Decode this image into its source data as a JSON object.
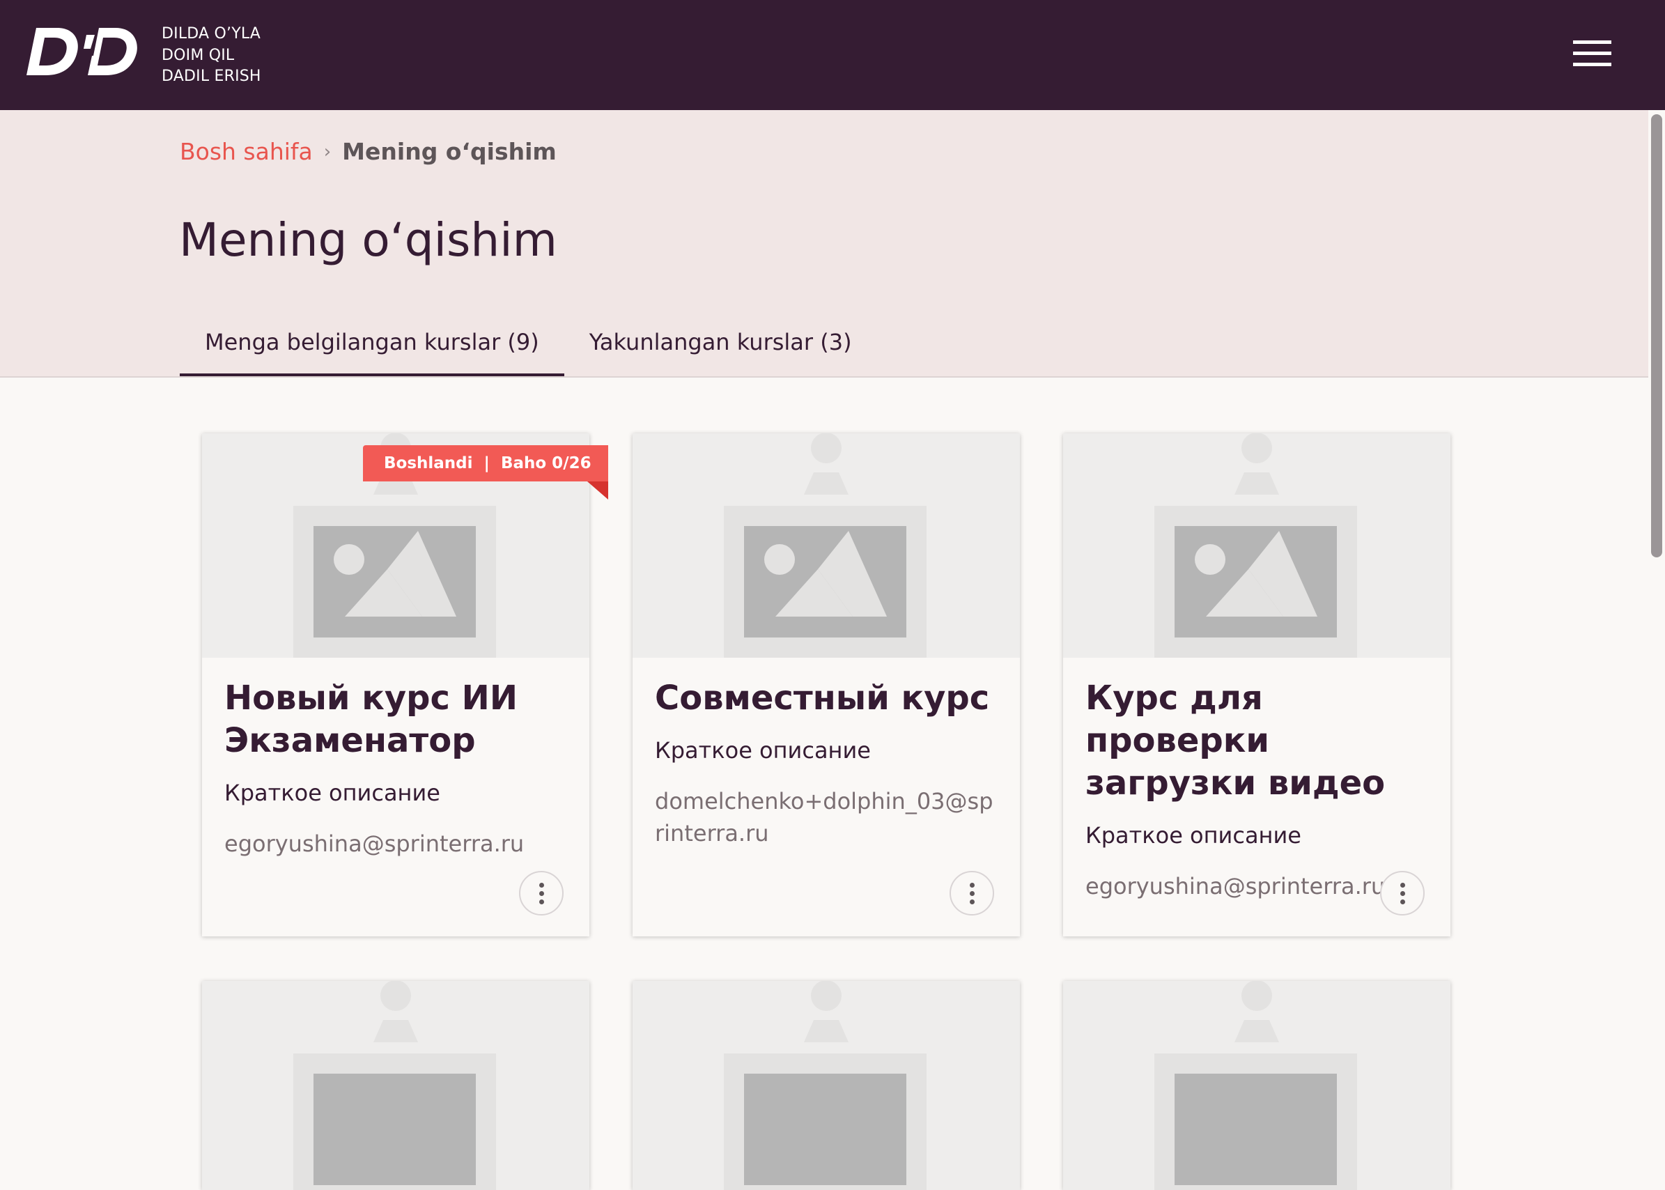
{
  "app": {
    "tagline": [
      "DILDA O’YLA",
      "DOIM QIL",
      "DADIL ERISH"
    ]
  },
  "header": {
    "menu_icon": "hamburger-menu-icon"
  },
  "breadcrumb": {
    "home": "Bosh sahifa",
    "separator": "›",
    "current": "Mening o‘qishim"
  },
  "page": {
    "title": "Mening o‘qishim"
  },
  "tabs": [
    {
      "label": "Menga belgilangan kurslar (9)",
      "active": true
    },
    {
      "label": "Yakunlangan kurslar (3)",
      "active": false
    }
  ],
  "status_ribbon": {
    "text": "Boshlandi  |  Baho 0/26"
  },
  "courses": [
    {
      "title": "Новый курс ИИ Экзаменатор",
      "description": "Краткое описание",
      "author": "egoryushina@sprinterra.ru"
    },
    {
      "title": "Совместный курс",
      "description": "Краткое описание",
      "author": "domelchenko+dolphin_03@sprinterra.ru"
    },
    {
      "title": "Курс для проверки загрузки видео",
      "description": "Краткое описание",
      "author": "egoryushina@sprinterra.ru"
    }
  ],
  "colors": {
    "header_bg": "#351c33",
    "hero_bg": "#f1e6e5",
    "accent": "#e8554e",
    "ribbon": "#f25a55",
    "page_bg": "#faf8f6"
  }
}
